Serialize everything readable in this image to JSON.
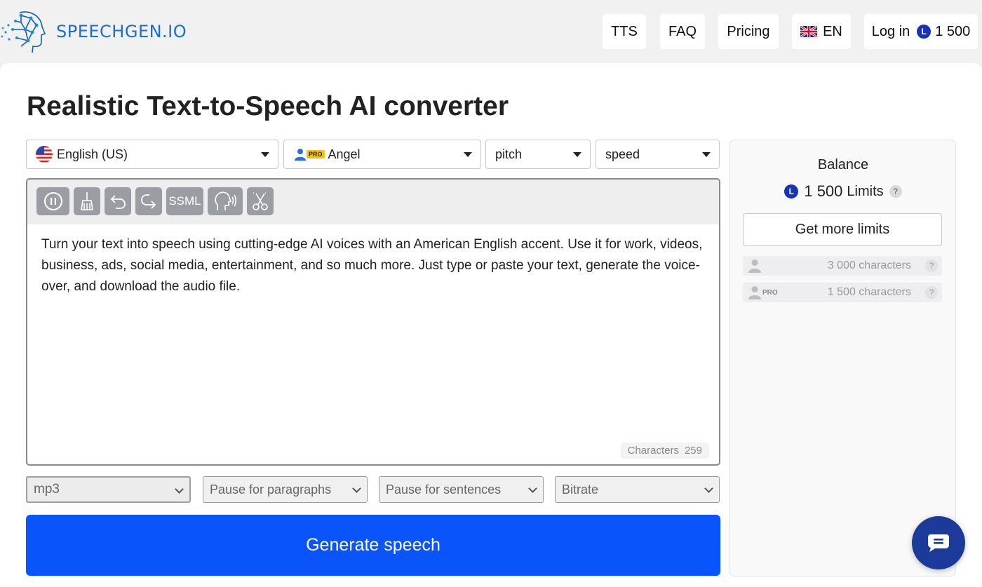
{
  "brand": {
    "name": "SPEECHGEN.IO"
  },
  "nav": {
    "tts": "TTS",
    "faq": "FAQ",
    "pricing": "Pricing",
    "language": "EN",
    "login": "Log in",
    "coin_letter": "L",
    "balance": "1 500"
  },
  "main": {
    "title": "Realistic Text-to-Speech AI converter",
    "language_select": "English (US)",
    "voice_select": {
      "badge": "PRO",
      "value": "Angel"
    },
    "pitch_select": "pitch",
    "speed_select": "speed"
  },
  "toolbar": {
    "ssml_label": "SSML"
  },
  "editor": {
    "text": "Turn your text into speech using cutting-edge AI voices with an American English accent. Use it for work, videos, business, ads, social media, entertainment, and so much more. Just type or paste your text, generate the voice-over, and download the audio file.",
    "characters_label": "Characters",
    "characters_count": "259"
  },
  "options": {
    "format": "mp3",
    "pause_paragraphs": "Pause for paragraphs",
    "pause_sentences": "Pause for sentences",
    "bitrate": "Bitrate"
  },
  "generate_label": "Generate speech",
  "side": {
    "balance_label": "Balance",
    "coin_letter": "L",
    "balance_value": "1 500",
    "limits_label": "Limits",
    "help": "?",
    "more_limits": "Get more limits",
    "limits": [
      {
        "value": "3 000 characters"
      },
      {
        "badge": "PRO",
        "value": "1 500 characters"
      }
    ]
  },
  "colors": {
    "primary": "#0a54fb",
    "brand_blue": "#1a6fd0",
    "coin": "#1634b8",
    "chat": "#1b3a9a"
  }
}
